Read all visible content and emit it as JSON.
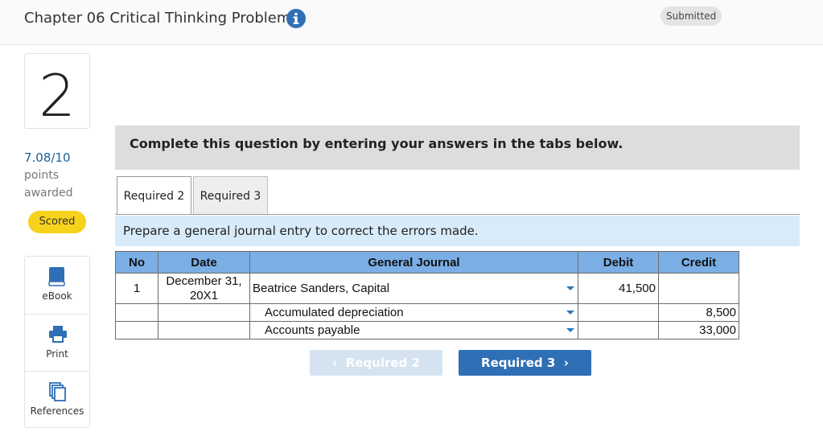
{
  "header": {
    "title": "Chapter 06 Critical Thinking Problems",
    "status": "Submitted"
  },
  "question": {
    "number": "2",
    "score": "7.08/10",
    "points_line1": "points",
    "points_line2": "awarded",
    "badge": "Scored"
  },
  "tools": [
    {
      "label": "eBook",
      "icon": "book-icon"
    },
    {
      "label": "Print",
      "icon": "printer-icon"
    },
    {
      "label": "References",
      "icon": "references-icon"
    }
  ],
  "banner": "Complete this question by entering your answers in the tabs below.",
  "tabs": [
    {
      "label": "Required 2",
      "active": true
    },
    {
      "label": "Required 3",
      "active": false
    }
  ],
  "instruction": "Prepare a general journal entry to correct the errors made.",
  "journal": {
    "headers": [
      "No",
      "Date",
      "General Journal",
      "Debit",
      "Credit"
    ],
    "rows": [
      {
        "no": "1",
        "date": "December 31, 20X1",
        "account": "Beatrice Sanders, Capital",
        "debit": "41,500",
        "credit": ""
      },
      {
        "no": "",
        "date": "",
        "account": "Accumulated depreciation",
        "debit": "",
        "credit": "8,500"
      },
      {
        "no": "",
        "date": "",
        "account": "Accounts payable",
        "debit": "",
        "credit": "33,000"
      }
    ]
  },
  "nav": {
    "prev": "Required 2",
    "next": "Required 3"
  },
  "colors": {
    "accent": "#2f6fb5",
    "table_header": "#7aaee4",
    "instruction_bg": "#d8ebfa",
    "badge": "#f6d21c"
  }
}
